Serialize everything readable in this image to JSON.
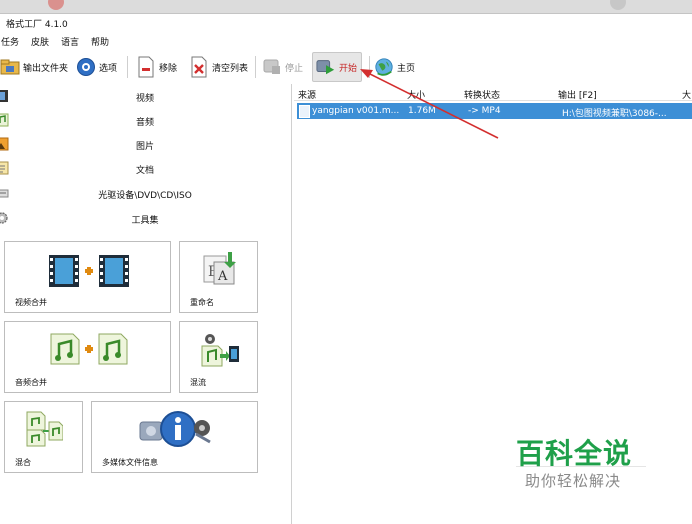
{
  "window": {
    "title": "格式工厂 4.1.0"
  },
  "menu": [
    "任务",
    "皮肤",
    "语言",
    "帮助"
  ],
  "toolbar": {
    "output_folder": "输出文件夹",
    "options": "选项",
    "remove": "移除",
    "clear_list": "清空列表",
    "stop": "停止",
    "start": "开始",
    "home": "主页"
  },
  "categories": [
    "视频",
    "音频",
    "图片",
    "文档",
    "光驱设备\\DVD\\CD\\ISO",
    "工具集"
  ],
  "tools": {
    "video_merge": "视频合并",
    "rename": "重命名",
    "audio_merge": "音频合并",
    "mux": "混流",
    "mix": "混合",
    "media_info": "多媒体文件信息"
  },
  "grid": {
    "columns": [
      "来源",
      "大小",
      "转换状态",
      "输出 [F2]",
      "大"
    ],
    "rows": [
      {
        "source": "yangpian v001.m...",
        "size": "1.76M",
        "status": "-> MP4",
        "output": "H:\\包图视频兼职\\3086-..."
      }
    ]
  },
  "watermark": {
    "main": "百科全说",
    "sub": "助你轻松解决"
  },
  "colors": {
    "selected_row": "#3d8fd6",
    "start_label": "#c62828",
    "watermark_green": "#1fa04a",
    "arrow": "#d32f2f"
  }
}
